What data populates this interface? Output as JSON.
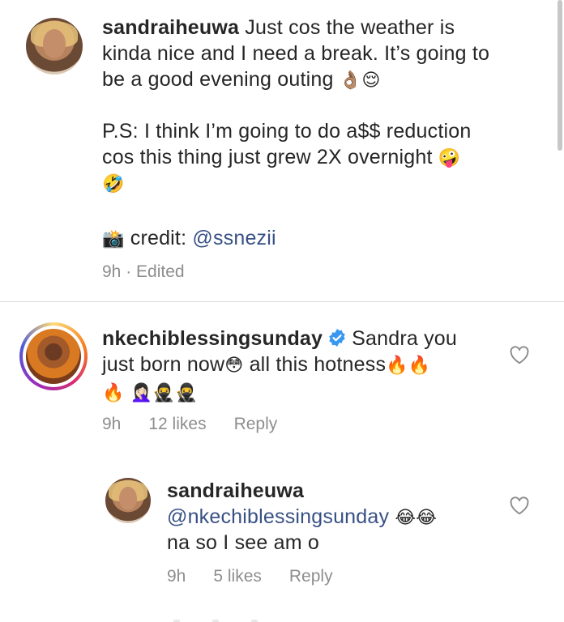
{
  "caption": {
    "username": "sandraiheuwa",
    "line1_text": "Just cos the weather is",
    "line2": "kinda nice and I need a break. It’s going to",
    "line3_text": "be a good evening outing",
    "line3_emojis": "👌🏽😌",
    "line4": "P.S: I think I’m going to do a$$ reduction",
    "line5_text": "cos this thing just grew 2X overnight",
    "line5_emoji": "🤪",
    "line6_emoji": "🤣",
    "credit_icon": "📸",
    "credit_label": "credit: ",
    "credit_handle": "@ssnezii",
    "meta_time": "9h",
    "meta_sep": " · ",
    "meta_edited": "Edited"
  },
  "comments": [
    {
      "username": "nkechiblessingsunday",
      "verified": true,
      "line1_text": "Sandra you",
      "line2_text": "just born now",
      "line2_emoji": "😳",
      "line2_text2": " all this hotness",
      "line2_emojis": "🔥🔥",
      "line3_emojis": "🔥 🤦🏻‍♀️🥷🥷",
      "time": "9h",
      "likes": "12 likes",
      "reply": "Reply"
    },
    {
      "username": "sandraiheuwa",
      "mention": "@nkechiblessingsunday",
      "mention_emojis": "😂😂",
      "line2": "na so I see am o",
      "time": "9h",
      "likes": "5 likes",
      "reply": "Reply"
    }
  ],
  "icons": {
    "heart": "heart-outline-icon",
    "verified": "verified-badge-icon",
    "camera": "camera-flash-icon"
  },
  "colors": {
    "text": "#262626",
    "muted": "#8e8e8e",
    "link": "#385185",
    "verified": "#3897f0",
    "divider": "#dbdbdb"
  }
}
